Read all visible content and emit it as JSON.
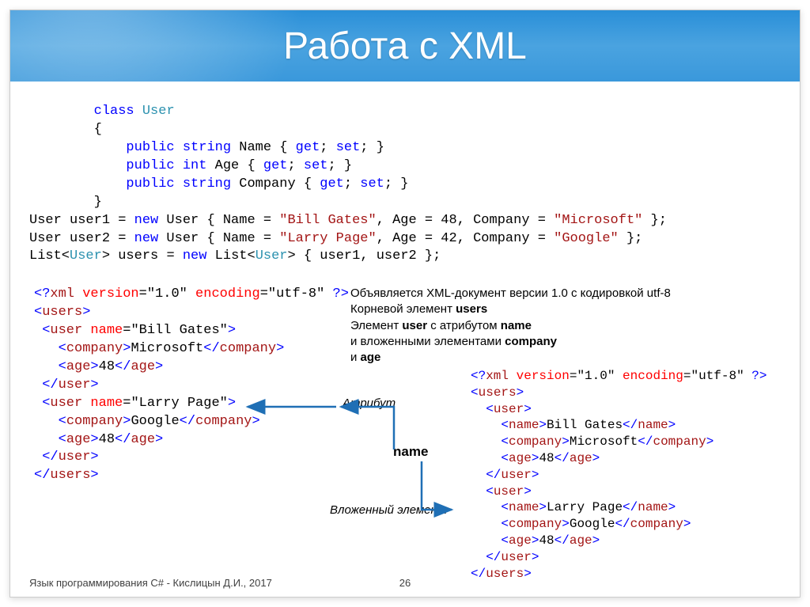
{
  "title": "Работа с XML",
  "code_class": {
    "l1": "class User",
    "l2": "{",
    "l3_kw": "public string",
    "l3_name": " Name { ",
    "l3_get": "get",
    "l3_sep": "; ",
    "l3_set": "set",
    "l3_end": "; }",
    "l4_kw": "public int",
    "l4_name": " Age { ",
    "l4_get": "get",
    "l4_sep": "; ",
    "l4_set": "set",
    "l4_end": "; }",
    "l5_kw": "public string",
    "l5_name": " Company { ",
    "l5_get": "get",
    "l5_sep": "; ",
    "l5_set": "set",
    "l5_end": "; }",
    "l6": "}"
  },
  "code_init": {
    "u1a": "User user1 = ",
    "u1new": "new",
    "u1b": " User { Name = ",
    "u1name": "\"Bill Gates\"",
    "u1c": ", Age = 48, Company = ",
    "u1comp": "\"Microsoft\"",
    "u1end": " };",
    "u2a": "User user2 = ",
    "u2new": "new",
    "u2b": " User { Name = ",
    "u2name": "\"Larry Page\"",
    "u2c": ", Age = 42, Company = ",
    "u2comp": "\"Google\"",
    "u2end": " };",
    "l3a": "List<",
    "l3cls": "User",
    "l3b": "> users = ",
    "l3new": "new",
    "l3c": " List<",
    "l3cls2": "User",
    "l3d": "> { user1, user2 };"
  },
  "xml_left": {
    "pi1": "<?",
    "pi2": "xml ",
    "pi_vattr": "version",
    "pi_eq": "=",
    "pi_vval": "\"1.0\"",
    "pi_eattr": " encoding",
    "pi_eval": "\"utf-8\"",
    "pi3": " ?>",
    "users_o": "users",
    "user_o": "user ",
    "user_attr": "name",
    "user_eq": "=",
    "u1_val": "\"Bill Gates\"",
    "company": "company",
    "c1": "Microsoft",
    "age": "age",
    "a1": "48",
    "u2_val": "\"Larry Page\"",
    "c2": "Google",
    "a2": "48"
  },
  "desc": {
    "l1a": "Объявляется XML-документ версии 1.0 с кодировкой utf-8",
    "l2a": "Корневой элемент ",
    "l2b": "users",
    "l3a": "Элемент ",
    "l3b": "user",
    "l3c": " с атрибутом ",
    "l3d": "name",
    "l4a": "и вложенными элементами ",
    "l4b": "company",
    "l5a": " и ",
    "l5b": "age"
  },
  "xml_right": {
    "n1": "Bill Gates",
    "c1": "Microsoft",
    "a1": "48",
    "n2": "Larry Page",
    "c2": "Google",
    "a2": "48",
    "name": "name",
    "company": "company",
    "age": "age",
    "user": "user",
    "users": "users"
  },
  "labels": {
    "attr": "Атрибут",
    "nested": "Вложенный элемент",
    "name": "name"
  },
  "footer": {
    "left": "Язык программирования C# - Кислицын Д.И., 2017",
    "page": "26"
  }
}
